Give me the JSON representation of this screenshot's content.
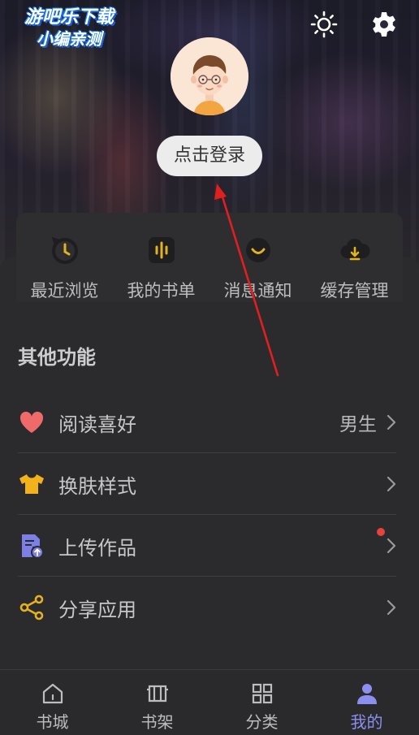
{
  "watermark": {
    "line1": "游吧乐下载",
    "line2": "小编亲测"
  },
  "header": {
    "theme_icon": "sun-icon",
    "settings_icon": "gear-icon",
    "login_label": "点击登录"
  },
  "quick_actions": [
    {
      "label": "最近浏览",
      "icon": "clock-history-icon"
    },
    {
      "label": "我的书单",
      "icon": "booklist-icon"
    },
    {
      "label": "消息通知",
      "icon": "notification-icon"
    },
    {
      "label": "缓存管理",
      "icon": "cloud-download-icon"
    }
  ],
  "other_section": {
    "title": "其他功能",
    "items": [
      {
        "label": "阅读喜好",
        "value": "男生",
        "icon": "heart-icon"
      },
      {
        "label": "换肤样式",
        "value": "",
        "icon": "tshirt-icon"
      },
      {
        "label": "上传作品",
        "value": "",
        "icon": "upload-document-icon",
        "badge": true
      },
      {
        "label": "分享应用",
        "value": "",
        "icon": "share-icon"
      }
    ]
  },
  "bottom_nav": [
    {
      "label": "书城",
      "icon": "home-icon"
    },
    {
      "label": "书架",
      "icon": "bookshelf-icon"
    },
    {
      "label": "分类",
      "icon": "grid-icon"
    },
    {
      "label": "我的",
      "icon": "user-icon",
      "active": true
    }
  ],
  "colors": {
    "accent": "#8c8ff0",
    "icon_yellow": "#e3b21d",
    "heart": "#ef6b6b",
    "badge": "#e5433b",
    "arrow": "#e01f1f"
  }
}
